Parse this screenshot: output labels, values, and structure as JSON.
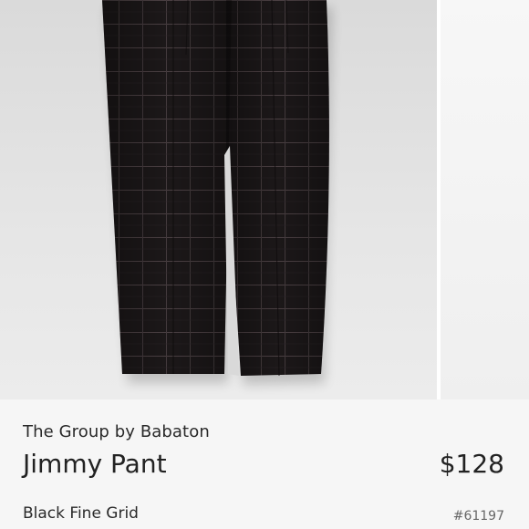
{
  "product": {
    "brand": "The Group by Babaton",
    "name": "Jimmy Pant",
    "price": "$128",
    "variant": "Black Fine Grid",
    "sku": "#61197"
  },
  "gallery": {
    "image_alt": "Jimmy Pant in Black Fine Grid"
  },
  "colors": {
    "fabric": "#1c1819",
    "grid_line": "#4a3f42",
    "background": "#f6f6f6"
  }
}
